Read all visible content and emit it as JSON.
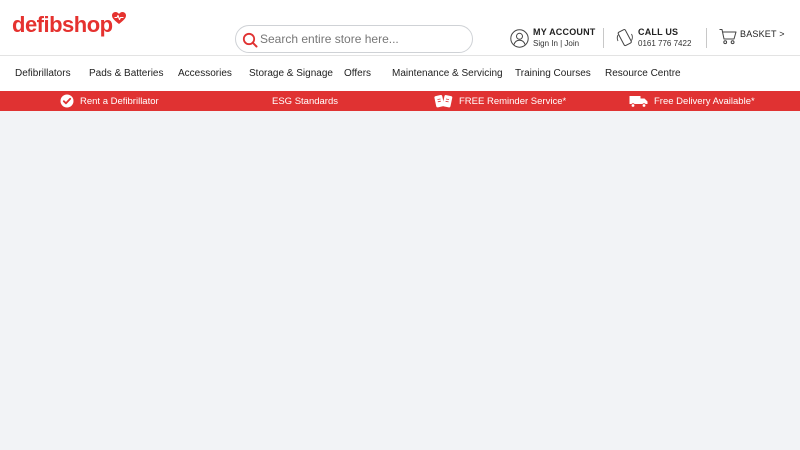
{
  "brand": {
    "name": "defibshop",
    "color": "#e5322f"
  },
  "search": {
    "placeholder": "Search entire store here..."
  },
  "account": {
    "title": "MY ACCOUNT",
    "links": "Sign In | Join",
    "icon": "user-icon"
  },
  "call": {
    "title": "CALL US",
    "number": "0161 776 7422",
    "icon": "phone-icon"
  },
  "basket": {
    "label": "BASKET >",
    "icon": "basket-icon"
  },
  "nav": {
    "items": [
      "Defibrillators",
      "Pads & Batteries",
      "Accessories",
      "Storage & Signage",
      "Offers",
      "Maintenance & Servicing",
      "Training Courses",
      "Resource Centre"
    ]
  },
  "promo": {
    "background": "#e03232",
    "items": [
      {
        "label": "Rent a Defibrillator",
        "icon": "check-circle-icon"
      },
      {
        "label": "ESG Standards",
        "icon": ""
      },
      {
        "label": "FREE Reminder Service*",
        "icon": "reminder-cards-icon"
      },
      {
        "label": "Free Delivery Available*",
        "icon": "delivery-truck-icon"
      }
    ]
  }
}
